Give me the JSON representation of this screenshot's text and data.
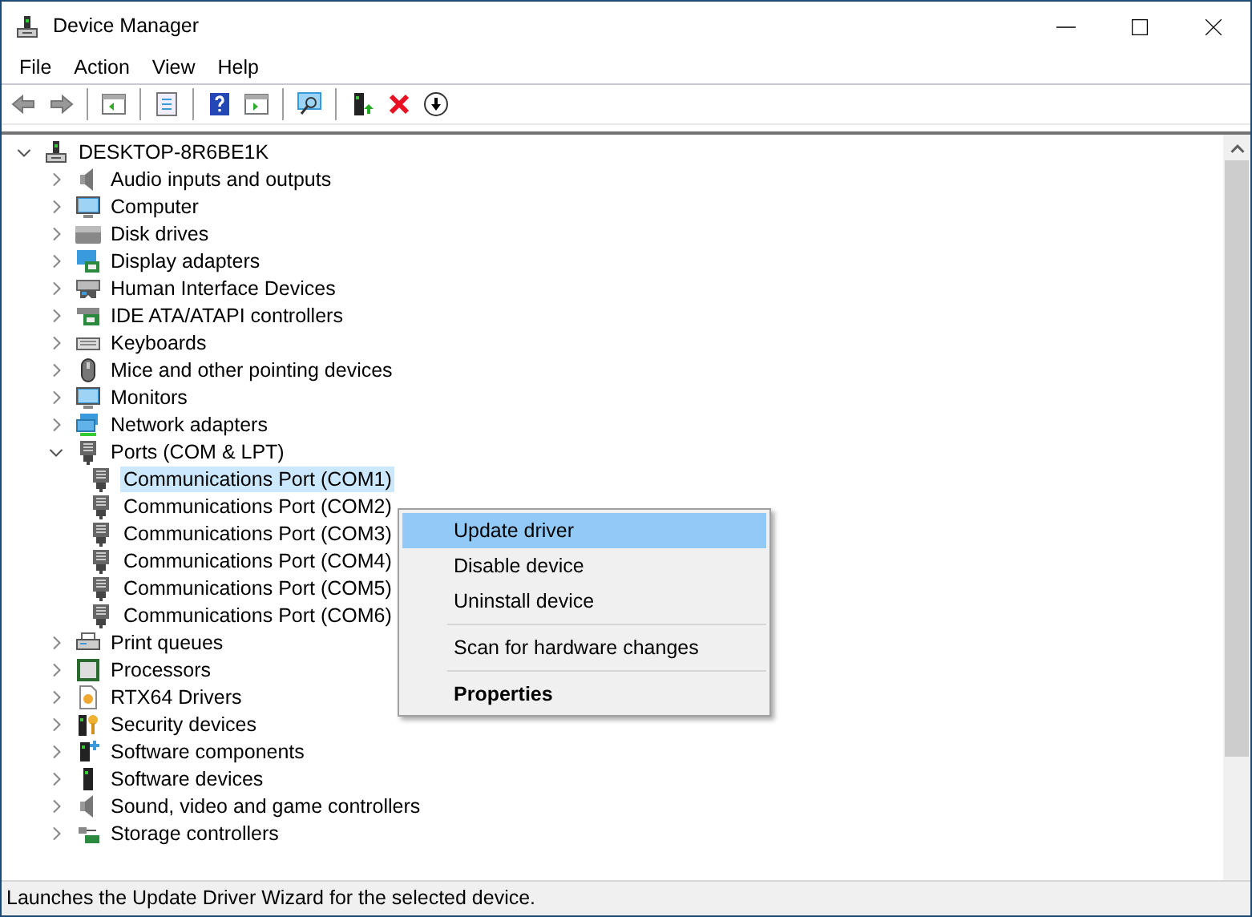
{
  "window": {
    "title": "Device Manager"
  },
  "menu": [
    "File",
    "Action",
    "View",
    "Help"
  ],
  "tree": {
    "label": "DESKTOP-8R6BE1K",
    "kind": "computer",
    "expanded": true,
    "selected": false,
    "children": [
      {
        "label": "Audio inputs and outputs",
        "kind": "speaker",
        "expanded": false,
        "selected": false
      },
      {
        "label": "Computer",
        "kind": "monitor",
        "expanded": false,
        "selected": false
      },
      {
        "label": "Disk drives",
        "kind": "disk",
        "expanded": false,
        "selected": false
      },
      {
        "label": "Display adapters",
        "kind": "display",
        "expanded": false,
        "selected": false
      },
      {
        "label": "Human Interface Devices",
        "kind": "hid",
        "expanded": false,
        "selected": false
      },
      {
        "label": "IDE ATA/ATAPI controllers",
        "kind": "ide",
        "expanded": false,
        "selected": false
      },
      {
        "label": "Keyboards",
        "kind": "keyboard",
        "expanded": false,
        "selected": false
      },
      {
        "label": "Mice and other pointing devices",
        "kind": "mouse",
        "expanded": false,
        "selected": false
      },
      {
        "label": "Monitors",
        "kind": "monitor",
        "expanded": false,
        "selected": false
      },
      {
        "label": "Network adapters",
        "kind": "network",
        "expanded": false,
        "selected": false
      },
      {
        "label": "Ports (COM & LPT)",
        "kind": "port",
        "expanded": true,
        "selected": false,
        "children": [
          {
            "label": "Communications Port (COM1)",
            "kind": "port",
            "selected": true
          },
          {
            "label": "Communications Port (COM2)",
            "kind": "port",
            "selected": false
          },
          {
            "label": "Communications Port (COM3)",
            "kind": "port",
            "selected": false
          },
          {
            "label": "Communications Port (COM4)",
            "kind": "port",
            "selected": false
          },
          {
            "label": "Communications Port (COM5)",
            "kind": "port",
            "selected": false
          },
          {
            "label": "Communications Port (COM6)",
            "kind": "port",
            "selected": false
          }
        ]
      },
      {
        "label": "Print queues",
        "kind": "printer",
        "expanded": false,
        "selected": false
      },
      {
        "label": "Processors",
        "kind": "processor",
        "expanded": false,
        "selected": false
      },
      {
        "label": "RTX64 Drivers",
        "kind": "driver",
        "expanded": false,
        "selected": false
      },
      {
        "label": "Security devices",
        "kind": "security",
        "expanded": false,
        "selected": false
      },
      {
        "label": "Software components",
        "kind": "component",
        "expanded": false,
        "selected": false
      },
      {
        "label": "Software devices",
        "kind": "device",
        "expanded": false,
        "selected": false
      },
      {
        "label": "Sound, video and game controllers",
        "kind": "speaker",
        "expanded": false,
        "selected": false
      },
      {
        "label": "Storage controllers",
        "kind": "storage",
        "expanded": false,
        "selected": false
      }
    ]
  },
  "context_menu": [
    {
      "label": "Update driver",
      "kind": "item",
      "selected": true
    },
    {
      "label": "Disable device",
      "kind": "item",
      "selected": false
    },
    {
      "label": "Uninstall device",
      "kind": "item",
      "selected": false
    },
    {
      "kind": "separator"
    },
    {
      "label": "Scan for hardware changes",
      "kind": "item",
      "selected": false
    },
    {
      "kind": "separator"
    },
    {
      "label": "Properties",
      "kind": "default",
      "selected": false
    }
  ],
  "status_bar": "Launches the Update Driver Wizard for the selected device."
}
